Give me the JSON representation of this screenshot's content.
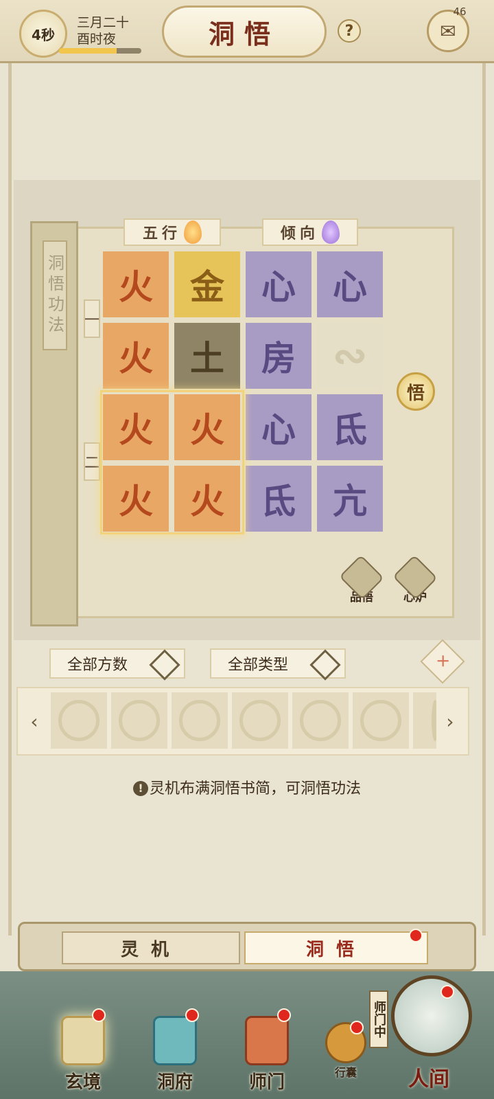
{
  "header": {
    "timer": "4秒",
    "date_line1": "三月二十",
    "date_line2": "酉时夜",
    "title": "洞悟",
    "help_icon": "?",
    "chat_count": "46",
    "time_progress": 0.7
  },
  "book": {
    "spine_title": "洞悟功法",
    "col_headers": [
      "五行",
      "倾向"
    ],
    "row_labels": [
      "一",
      "二"
    ],
    "tiles": [
      [
        "火",
        "金",
        "心",
        "心"
      ],
      [
        "火",
        "土",
        "房",
        ""
      ],
      [
        "火",
        "火",
        "心",
        "氐"
      ],
      [
        "火",
        "火",
        "氐",
        "亢"
      ]
    ],
    "wu_button": "悟",
    "side_buttons": [
      "品悟",
      "心炉"
    ]
  },
  "filters": {
    "quantity": "全部方数",
    "type": "全部类型"
  },
  "hint": "灵机布满洞悟书简，可洞悟功法",
  "segments": {
    "left": "灵机",
    "right": "洞悟"
  },
  "nav": {
    "items": [
      "玄境",
      "洞府",
      "师门"
    ],
    "bag": "行囊",
    "sect_tag": "师门中",
    "world": "人间"
  },
  "colors": {
    "fire_tile": "#e9a765",
    "gold_tile": "#e7c45a",
    "earth_tile": "#8f8566",
    "purple_tile": "#a89bc4",
    "title_red": "#7a2f1d",
    "notification_red": "#e0271d"
  }
}
